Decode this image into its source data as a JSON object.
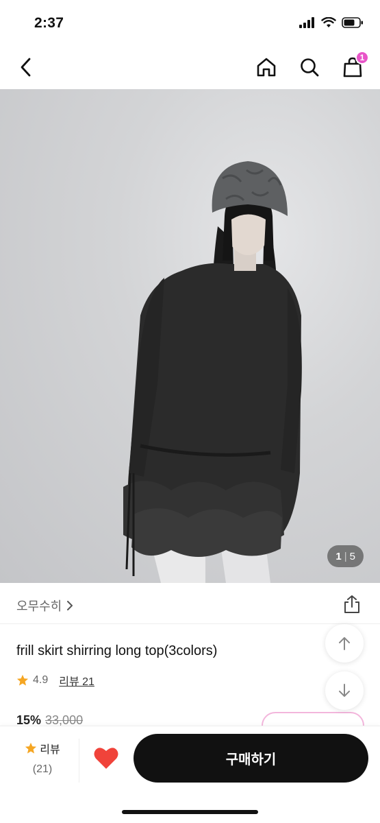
{
  "status_bar": {
    "time": "2:37"
  },
  "nav": {
    "cart_count": "1"
  },
  "gallery": {
    "current": "1",
    "separator": "|",
    "total": "5"
  },
  "brand": {
    "name": "오무수히"
  },
  "product": {
    "title": "frill skirt shirring long top(3colors)",
    "rating": "4.9",
    "review_link": "리뷰 21",
    "discount": "15%",
    "original_price": "33,000"
  },
  "bottom_bar": {
    "review_label": "리뷰",
    "review_count": "(21)",
    "buy_label": "구매하기"
  },
  "colors": {
    "accent_pink": "#e855c8",
    "star": "#f5a623",
    "heart": "#f0433a",
    "buy_button": "#111111"
  }
}
